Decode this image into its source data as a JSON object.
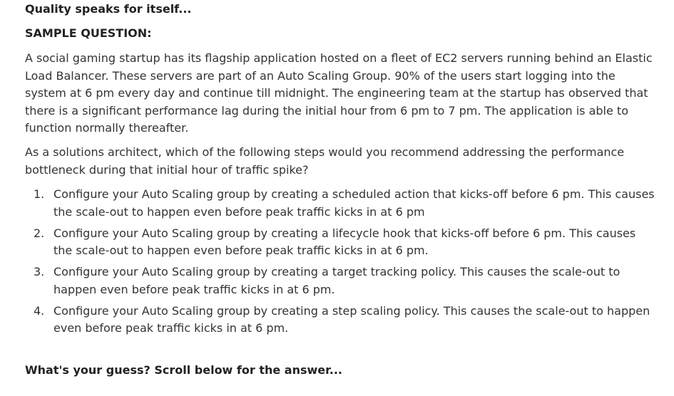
{
  "intro": "Quality speaks for itself...",
  "sample_label": "SAMPLE QUESTION:",
  "question": "A social gaming startup has its flagship application hosted on a fleet of EC2 servers running behind an Elastic Load Balancer. These servers are part of an Auto Scaling Group. 90% of the users start logging into the system at 6 pm every day and continue till midnight. The engineering team at the startup has observed that there is a significant performance lag during the initial hour from 6 pm to 7 pm. The application is able to function normally thereafter.",
  "prompt": "As a solutions architect, which of the following steps would you recommend addressing the performance bottleneck during that initial hour of traffic spike?",
  "options": [
    {
      "number": "1.",
      "text": "Configure your Auto Scaling group by creating a scheduled action that kicks-off before 6 pm. This causes the scale-out to happen even before peak traffic kicks in at 6 pm"
    },
    {
      "number": "2.",
      "text": "Configure your Auto Scaling group by creating a lifecycle hook that kicks-off before 6 pm. This causes the scale-out to happen even before peak traffic kicks in at 6 pm."
    },
    {
      "number": "3.",
      "text": "Configure your Auto Scaling group by creating a target tracking policy. This causes the scale-out to happen even before peak traffic kicks in at 6 pm."
    },
    {
      "number": "4.",
      "text": "Configure your Auto Scaling group by creating a step scaling policy. This causes the scale-out to happen even before peak traffic kicks in at 6 pm."
    }
  ],
  "footer": "What's your guess? Scroll below for the answer..."
}
